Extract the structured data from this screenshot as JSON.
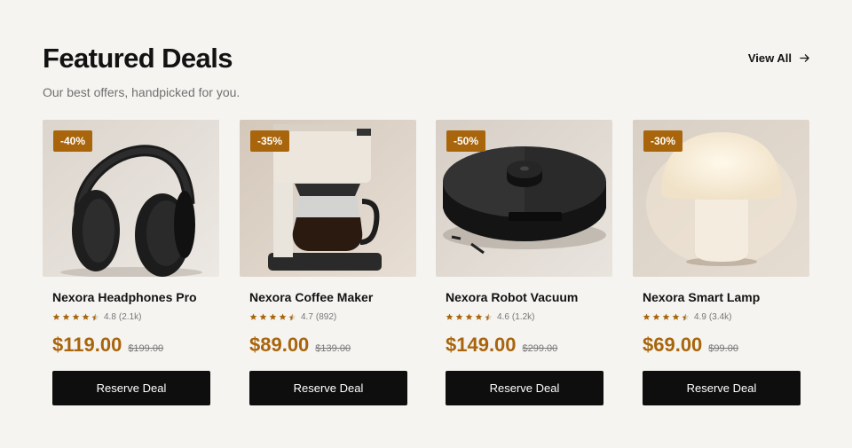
{
  "header": {
    "title": "Featured Deals",
    "subtitle": "Our best offers, handpicked for you.",
    "view_all": "View All",
    "view_all_icon": "arrow-right-icon"
  },
  "colors": {
    "accent": "#a8650c",
    "button_bg": "#0e0e0e",
    "page_bg": "#f6f4f1"
  },
  "products": [
    {
      "name": "Nexora Headphones Pro",
      "discount": "-40%",
      "rating": "4.8",
      "reviews": "(2.1k)",
      "stars": 4.5,
      "price": "$119.00",
      "old_price": "$199.00",
      "cta": "Reserve Deal",
      "image_icon": "headphones-image"
    },
    {
      "name": "Nexora Coffee Maker",
      "discount": "-35%",
      "rating": "4.7",
      "reviews": "(892)",
      "stars": 4.5,
      "price": "$89.00",
      "old_price": "$139.00",
      "cta": "Reserve Deal",
      "image_icon": "coffee-maker-image"
    },
    {
      "name": "Nexora Robot Vacuum",
      "discount": "-50%",
      "rating": "4.6",
      "reviews": "(1.2k)",
      "stars": 4.5,
      "price": "$149.00",
      "old_price": "$299.00",
      "cta": "Reserve Deal",
      "image_icon": "robot-vacuum-image"
    },
    {
      "name": "Nexora Smart Lamp",
      "discount": "-30%",
      "rating": "4.9",
      "reviews": "(3.4k)",
      "stars": 4.5,
      "price": "$69.00",
      "old_price": "$99.00",
      "cta": "Reserve Deal",
      "image_icon": "lamp-image"
    }
  ]
}
